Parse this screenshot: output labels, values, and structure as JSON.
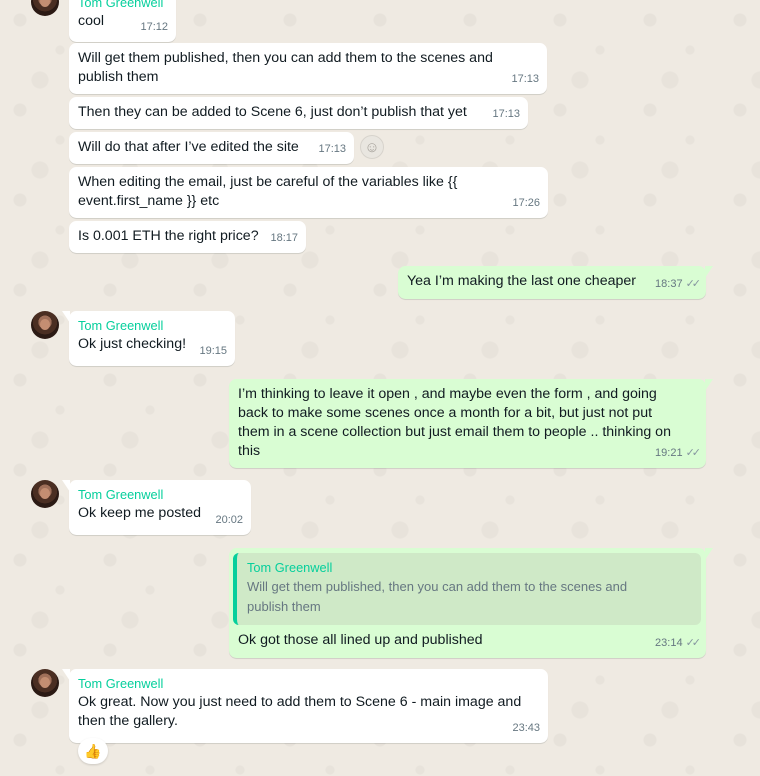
{
  "contact": {
    "name": "Tom Greenwell"
  },
  "messages": [
    {
      "text": "cool",
      "time": "17:12"
    },
    {
      "text": "Will get them published, then you can add them to the scenes and\npublish them",
      "time": "17:13"
    },
    {
      "text": "Then they can be added to Scene 6, just don’t publish that yet",
      "time": "17:13"
    },
    {
      "text": "Will do that after I’ve edited the site",
      "time": "17:13"
    },
    {
      "text": "When editing the email, just be careful of the variables like {{\nevent.first_name }} etc",
      "time": "17:26"
    },
    {
      "text": "Is 0.001 ETH the right price?",
      "time": "18:17"
    },
    {
      "text": "Yea I’m making the last one cheaper",
      "time": "18:37"
    },
    {
      "sender": "Tom Greenwell",
      "text": "Ok just checking!",
      "time": "19:15"
    },
    {
      "text": "I’m thinking to leave it open , and maybe even the form , and going\nback to make some scenes once a month for a bit, but just not put\nthem in a scene collection but just email them to people .. thinking on\nthis",
      "time": "19:21"
    },
    {
      "sender": "Tom Greenwell",
      "text": "Ok keep me posted",
      "time": "20:02"
    },
    {
      "quote_name": "Tom Greenwell",
      "quote_text": "Will get them published, then you can add them to the scenes and\npublish them",
      "text": "Ok got those all lined up and published",
      "time": "23:14"
    },
    {
      "sender": "Tom Greenwell",
      "text": "Ok great. Now you just need to add them to Scene 6 - main image and\nthen the gallery.",
      "time": "23:43",
      "reaction": "👍"
    }
  ],
  "ticks": "✓✓",
  "icons": {
    "emoji": "smiley-icon"
  }
}
